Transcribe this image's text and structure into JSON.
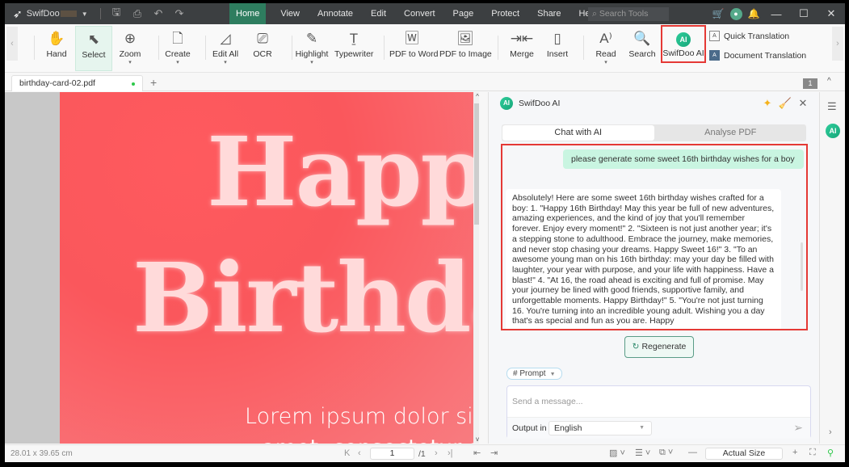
{
  "titlebar": {
    "app_name": "SwifDoo",
    "menu": [
      {
        "label": "Home",
        "active": true
      },
      {
        "label": "View"
      },
      {
        "label": "Annotate"
      },
      {
        "label": "Edit"
      },
      {
        "label": "Convert"
      },
      {
        "label": "Page"
      },
      {
        "label": "Protect"
      },
      {
        "label": "Share"
      },
      {
        "label": "Help"
      }
    ],
    "search_placeholder": "Search Tools"
  },
  "ribbon": {
    "tools": [
      {
        "label": "Hand",
        "icon": "hand-icon"
      },
      {
        "label": "Select",
        "icon": "cursor-icon",
        "selected": true
      },
      {
        "label": "Zoom",
        "icon": "zoom-in-icon",
        "dropdown": true
      },
      {
        "label": "Create",
        "icon": "create-file-icon",
        "dropdown": true
      },
      {
        "label": "Edit All",
        "icon": "edit-icon",
        "dropdown": true
      },
      {
        "label": "OCR",
        "icon": "ocr-icon"
      },
      {
        "label": "Highlight",
        "icon": "highlighter-icon",
        "dropdown": true
      },
      {
        "label": "Typewriter",
        "icon": "typewriter-icon"
      },
      {
        "label": "PDF to Word",
        "icon": "pdf-to-word-icon"
      },
      {
        "label": "PDF to Image",
        "icon": "pdf-to-image-icon"
      },
      {
        "label": "Merge",
        "icon": "merge-icon"
      },
      {
        "label": "Insert",
        "icon": "insert-icon"
      },
      {
        "label": "Read",
        "icon": "read-aloud-icon",
        "dropdown": true
      },
      {
        "label": "Search",
        "icon": "search-doc-icon"
      },
      {
        "label": "SwifDoo AI",
        "icon": "ai-icon",
        "highlighted": true
      }
    ],
    "quick_translation": "Quick Translation",
    "document_translation": "Document Translation",
    "ai_badge": "AI"
  },
  "tabs": {
    "doc_tab": "birthday-card-02.pdf",
    "page_badge": "1"
  },
  "document": {
    "line1": "Happy",
    "line2": "Birthday",
    "body": "Lorem ipsum dolor sit",
    "body2": "amet, consectetur adipiscing"
  },
  "ai_panel": {
    "title": "SwifDoo AI",
    "tabs": [
      {
        "label": "Chat with AI",
        "active": true
      },
      {
        "label": "Analyse PDF"
      }
    ],
    "user_message": "please generate some sweet 16th birthday wishes for a boy",
    "ai_message": "Absolutely! Here are some sweet 16th birthday wishes crafted for a boy: 1. \"Happy 16th Birthday! May this year be full of new adventures, amazing experiences, and the kind of joy that you'll remember forever. Enjoy every moment!\" 2. \"Sixteen is not just another year; it's a stepping stone to adulthood. Embrace the journey, make memories, and never stop chasing your dreams. Happy Sweet 16!\" 3. \"To an awesome young man on his 16th birthday: may your day be filled with laughter, your year with purpose, and your life with happiness. Have a blast!\" 4. \"At 16, the road ahead is exciting and full of promise. May your journey be lined with good friends, supportive family, and unforgettable moments. Happy Birthday!\" 5. \"You're not just turning 16. You're turning into an incredible young adult. Wishing you a day that's as special and fun as you are. Happy",
    "regenerate": "Regenerate",
    "prompt_chip": "# Prompt",
    "message_placeholder": "Send a message...",
    "output_label": "Output in",
    "output_language": "English"
  },
  "statusbar": {
    "dimensions": "28.01 x 39.65 cm",
    "current_page": "1",
    "total_pages": "/1",
    "zoom": "Actual Size"
  },
  "colors": {
    "accent": "#2e7d5f",
    "ai_green": "#1fb985",
    "highlight_border": "#e53935",
    "user_bubble": "#c9f5e1"
  }
}
